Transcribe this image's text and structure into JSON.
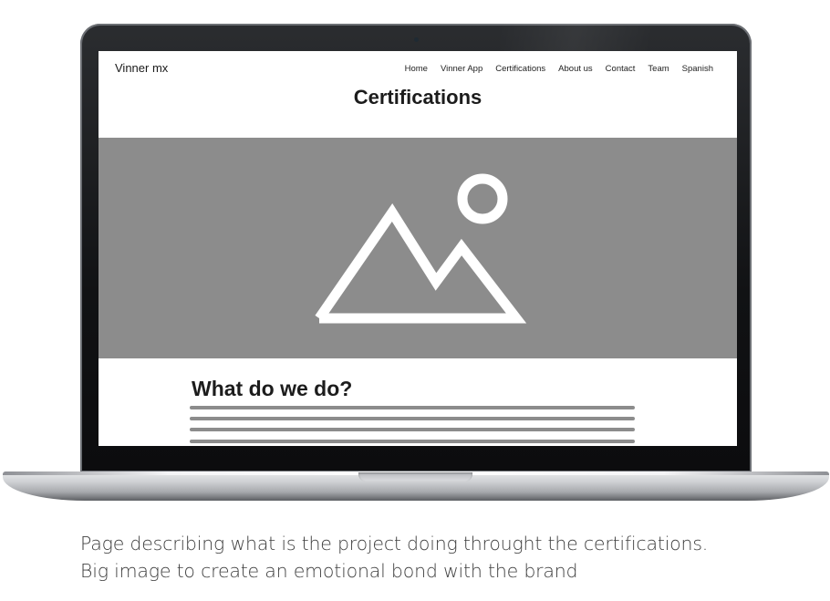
{
  "site": {
    "logo": "Vinner mx",
    "nav": [
      "Home",
      "Vinner App",
      "Certifications",
      "About us",
      "Contact",
      "Team",
      "Spanish"
    ],
    "page_title": "Certifications",
    "hero_icon": "image-placeholder-icon",
    "section_title": "What do we do?",
    "text_placeholder_lines": 4
  },
  "caption": {
    "line1": "Page describing what is the project doing throught the certifications.",
    "line2": "Big image to create an emotional bond with the brand"
  },
  "colors": {
    "hero_background": "#8c8c8c",
    "placeholder_lines": "#8c8c8c",
    "laptop_bezel": "#111214"
  }
}
